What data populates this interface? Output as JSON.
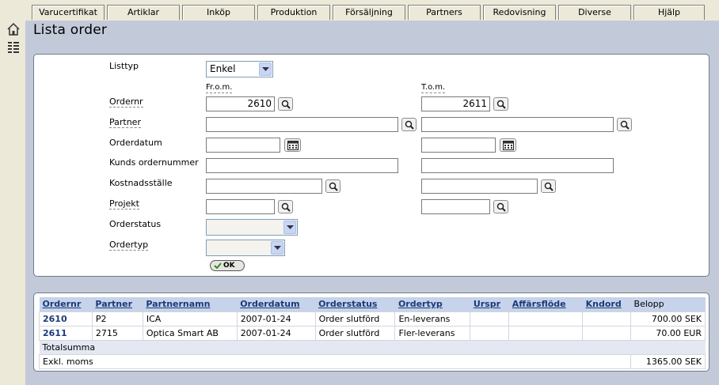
{
  "nav": {
    "tabs": [
      "Varucertifikat",
      "Artiklar",
      "Inköp",
      "Produktion",
      "Försäljning",
      "Partners",
      "Redovisning",
      "Diverse",
      "Hjälp"
    ]
  },
  "page": {
    "title": "Lista order"
  },
  "filter": {
    "listtyp_label": "Listtyp",
    "listtyp_value": "Enkel",
    "from_label": "Fr.o.m.",
    "to_label": "T.o.m.",
    "ordernr_label": "Ordernr",
    "ordernr_from": "2610",
    "ordernr_to": "2611",
    "partner_label": "Partner",
    "orderdatum_label": "Orderdatum",
    "kunds_ordernummer_label": "Kunds ordernummer",
    "kostnadsstalle_label": "Kostnadsställe",
    "projekt_label": "Projekt",
    "orderstatus_label": "Orderstatus",
    "ordertyp_label": "Ordertyp",
    "ok_label": "OK"
  },
  "results": {
    "columns": [
      "Ordernr",
      "Partner",
      "Partnernamn",
      "Orderdatum",
      "Orderstatus",
      "Ordertyp",
      "Urspr",
      "Affärsflöde",
      "Kndord",
      "Belopp"
    ],
    "rows": [
      {
        "ordernr": "2610",
        "partner": "P2",
        "partnernamn": "ICA",
        "orderdatum": "2007-01-24",
        "orderstatus": "Order slutförd",
        "ordertyp": "En-leverans",
        "urspr": "",
        "affarsflode": "",
        "kndord": "",
        "belopp": "700.00 SEK"
      },
      {
        "ordernr": "2611",
        "partner": "2715",
        "partnernamn": "Optica Smart AB",
        "orderdatum": "2007-01-24",
        "orderstatus": "Order slutförd",
        "ordertyp": "Fler-leverans",
        "urspr": "",
        "affarsflode": "",
        "kndord": "",
        "belopp": "70.00 EUR"
      }
    ],
    "totalsumma_label": "Totalsumma",
    "exkl_moms_label": "Exkl. moms",
    "exkl_moms_value": "1365.00 SEK"
  }
}
